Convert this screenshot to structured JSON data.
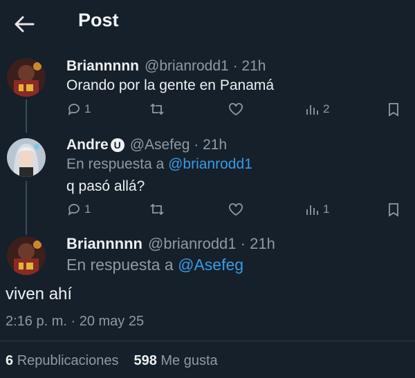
{
  "header": {
    "title": "Post",
    "back_icon": "arrow-left-icon"
  },
  "thread": [
    {
      "name": "Briannnnn",
      "handle": "@brianrodd1",
      "time_sep": " · ",
      "time": "21h",
      "text": "Orando por la gente en Panamá",
      "actions": {
        "replies": "1",
        "reposts": "",
        "likes": "",
        "views": "2"
      }
    },
    {
      "name": "Andre",
      "badge": "U",
      "handle": "@Asefeg",
      "time_sep": " · ",
      "time": "21h",
      "reply_prefix": "En respuesta a ",
      "reply_to": "@brianrodd1",
      "text": "q pasó allá?",
      "actions": {
        "replies": "1",
        "reposts": "",
        "likes": "",
        "views": "1"
      }
    }
  ],
  "main_post": {
    "name": "Briannnnn",
    "handle": "@brianrodd1",
    "time_sep": " · ",
    "time": "21h",
    "reply_prefix": "En respuesta a ",
    "reply_to": "@Asefeg",
    "text": "viven ahí",
    "timestamp": "2:16 p. m. · 20 may 25",
    "reposts_count": "6",
    "reposts_label": "Republicaciones",
    "likes_count": "598",
    "likes_label": "Me gusta"
  },
  "colors": {
    "background": "#15202b",
    "accent": "#3a9be4",
    "muted": "#8f9aa4"
  }
}
